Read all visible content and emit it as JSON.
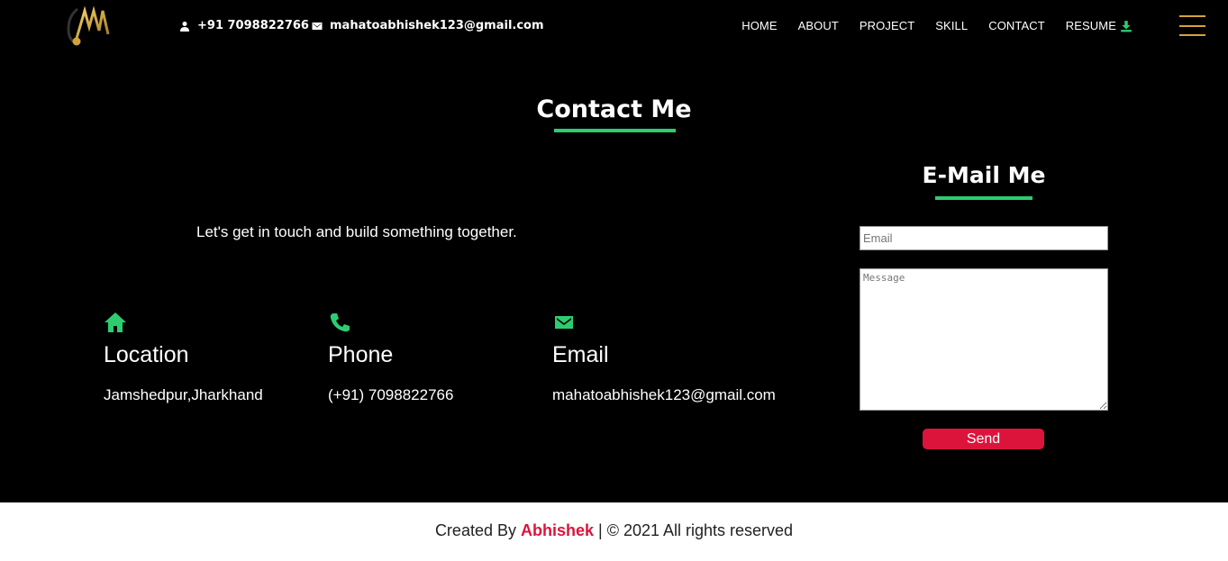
{
  "header": {
    "phone": "+91 7098822766",
    "email": "mahatoabhishek123@gmail.com",
    "nav": [
      "HOME",
      "ABOUT",
      "PROJECT",
      "SKILL",
      "CONTACT",
      "RESUME"
    ]
  },
  "contact": {
    "title": "Contact Me",
    "tagline": "Let's get in touch and build something together.",
    "items": [
      {
        "label": "Location",
        "value": "Jamshedpur,Jharkhand",
        "icon": "home-icon"
      },
      {
        "label": "Phone",
        "value": "(+91) 7098822766",
        "icon": "phone-icon"
      },
      {
        "label": "Email",
        "value": "mahatoabhishek123@gmail.com",
        "icon": "mail-icon"
      }
    ]
  },
  "email_form": {
    "title": "E-Mail Me",
    "email_placeholder": "Email",
    "message_placeholder": "Message",
    "send_label": "Send"
  },
  "footer": {
    "prefix": "Created By ",
    "author": "Abhishek",
    "suffix": " | © 2021 All rights reserved"
  },
  "colors": {
    "accent": "#2ecc71",
    "button": "#dc143c",
    "logo_gold": "#d4a23c"
  }
}
